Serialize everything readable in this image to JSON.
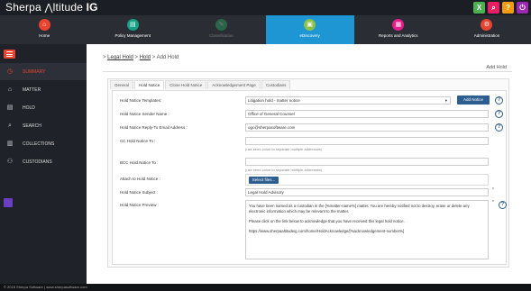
{
  "app": {
    "logo_prefix": "Sherpa ",
    "logo_mid": "ltitude ",
    "logo_suffix": "IG"
  },
  "top_icons": [
    {
      "name": "excel-icon",
      "glyph": "X",
      "color": "#4caf50"
    },
    {
      "name": "search-doc-icon",
      "glyph": "⌕",
      "color": "#e91e63"
    },
    {
      "name": "help-icon",
      "glyph": "?",
      "color": "#f39c12"
    },
    {
      "name": "power-icon",
      "glyph": "⏻",
      "color": "#9c27b0"
    }
  ],
  "nav": [
    {
      "label": "Home",
      "glyph": "⌂",
      "color": "#e8442f",
      "state": "normal"
    },
    {
      "label": "Policy Management",
      "glyph": "▤",
      "color": "#16a085",
      "state": "normal"
    },
    {
      "label": "Classification",
      "glyph": "✎",
      "color": "#2ecc71",
      "state": "disabled"
    },
    {
      "label": "eDiscovery",
      "glyph": "▣",
      "color": "#8bc34a",
      "state": "active"
    },
    {
      "label": "Reports and Analytics",
      "glyph": "▦",
      "color": "#e91e8c",
      "state": "normal"
    },
    {
      "label": "Administration",
      "glyph": "⚙",
      "color": "#e8442f",
      "state": "normal"
    }
  ],
  "sidebar": {
    "items": [
      {
        "label": "SUMMARY",
        "glyph": "◷",
        "active": true
      },
      {
        "label": "MATTER",
        "glyph": "⌂",
        "active": false
      },
      {
        "label": "HOLD",
        "glyph": "▤",
        "active": false
      },
      {
        "label": "SEARCH",
        "glyph": "⌕",
        "active": false
      },
      {
        "label": "COLLECTIONS",
        "glyph": "▥",
        "active": false
      },
      {
        "label": "CUSTODIANS",
        "glyph": "⚇",
        "active": false
      }
    ]
  },
  "footer": {
    "text": "© 2015 Sherpa Software | www.sherpasoftware.com"
  },
  "breadcrumb": {
    "item1": "Legal Hold",
    "sep": " > ",
    "item2": "Hold",
    "item3": "Add Hold",
    "lead": "> "
  },
  "page_heading": "Add Hold",
  "tabs": [
    "General",
    "Hold Notice",
    "Close Hold Notice",
    "Acknowledgement Page",
    "Custodians"
  ],
  "active_tab": "Hold Notice",
  "form": {
    "template_label": "Hold Notice Templates:",
    "template_value": "Litigation hold - matter notice",
    "add_notice_label": "Add Notice",
    "sender_label": "Hold Notice Sender Name :",
    "sender_value": "Office of General Counsel",
    "reply_label": "Hold Notice Reply-To Email Address :",
    "reply_value": "ogc@sherpasoftware.com",
    "cc_label": "CC Hold Notice To :",
    "cc_value": "",
    "cc_hint": "(use semi-colon to separate multiple addresses)",
    "bcc_label": "BCC Hold Notice To :",
    "bcc_value": "",
    "bcc_hint": "(use semi-colon to separate multiple addresses)",
    "attach_label": "Attach to Hold Notice :",
    "select_files_label": "Select files...",
    "subject_label": "Hold Notice Subject :",
    "subject_value": "Legal Hold Advisory",
    "preview_label": "Hold Notice Preview :",
    "preview_p1": "You have been named as a custodian in the [%matter-name%] matter. You are hereby notified not to destroy, erase or delete any electronic information which may be relevant to the matter.",
    "preview_p2": "Please click on the link below to acknowledge that you have received this legal hold notice.",
    "preview_p3": "https://www.sherpaaltitudeig.com/home/HoldAcknowledge/[%acknowledgement-number%]",
    "asterisk": "*",
    "help_glyph": "?",
    "dropdown_glyph": "▾"
  }
}
